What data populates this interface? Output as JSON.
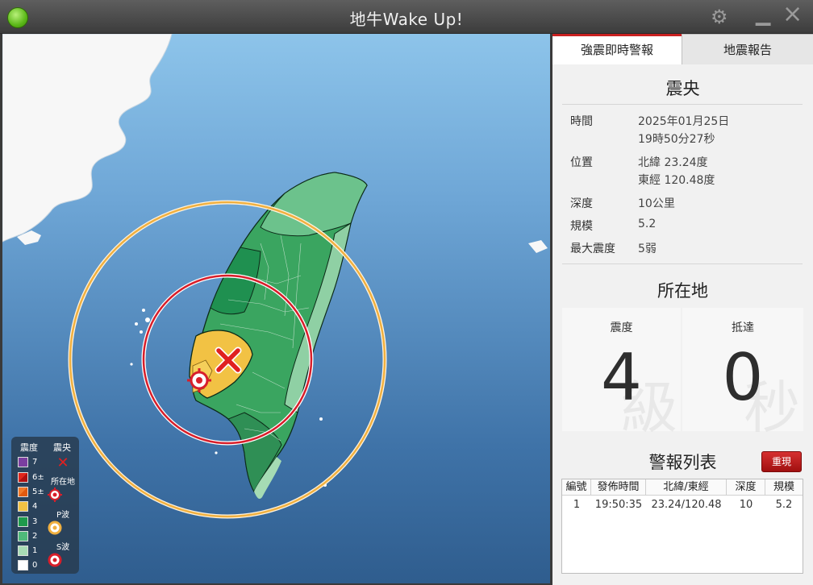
{
  "window": {
    "title": "地牛Wake Up!"
  },
  "titlebar_icons": {
    "settings": "gear-icon",
    "minimize": "minimize-icon",
    "close": "close-icon"
  },
  "tabs": [
    {
      "label": "強震即時警報",
      "active": true
    },
    {
      "label": "地震報告",
      "active": false
    }
  ],
  "epicenter": {
    "section_title": "震央",
    "rows": [
      {
        "label": "時間",
        "value": "2025年01月25日",
        "value2": "19時50分27秒"
      },
      {
        "label": "位置",
        "value": "北緯 23.24度",
        "value2": "東經 120.48度"
      },
      {
        "label": "深度",
        "value": "10公里"
      },
      {
        "label": "規模",
        "value": "5.2"
      },
      {
        "label": "最大震度",
        "value": "5弱"
      }
    ]
  },
  "location": {
    "section_title": "所在地",
    "intensity_label": "震度",
    "intensity_value": "4",
    "intensity_unit": "級",
    "arrival_label": "抵達",
    "arrival_value": "0",
    "arrival_unit": "秒"
  },
  "alerts": {
    "section_title": "警報列表",
    "replay_label": "重現",
    "columns": [
      "編號",
      "發佈時間",
      "北緯/東經",
      "深度",
      "規模"
    ],
    "rows": [
      [
        "1",
        "19:50:35",
        "23.24/120.48",
        "10",
        "5.2"
      ]
    ]
  },
  "legend": {
    "intensity_header": "震度",
    "epicenter_header": "震央",
    "location_label": "所在地",
    "p_wave_label": "P波",
    "s_wave_label": "S波",
    "levels": [
      {
        "label": "7",
        "color": "#7b3fa0"
      },
      {
        "label": "6±",
        "color": "#e0261c"
      },
      {
        "label": "5±",
        "color": "#f07a2a"
      },
      {
        "label": "4",
        "color": "#f2c244"
      },
      {
        "label": "3",
        "color": "#1e9a4c"
      },
      {
        "label": "2",
        "color": "#4fb97a"
      },
      {
        "label": "1",
        "color": "#a8dcb5"
      },
      {
        "label": "0",
        "color": "#ffffff"
      }
    ]
  },
  "colors": {
    "accent": "#c92020",
    "p_wave": "#f0b040",
    "s_wave": "#d81e2a"
  }
}
